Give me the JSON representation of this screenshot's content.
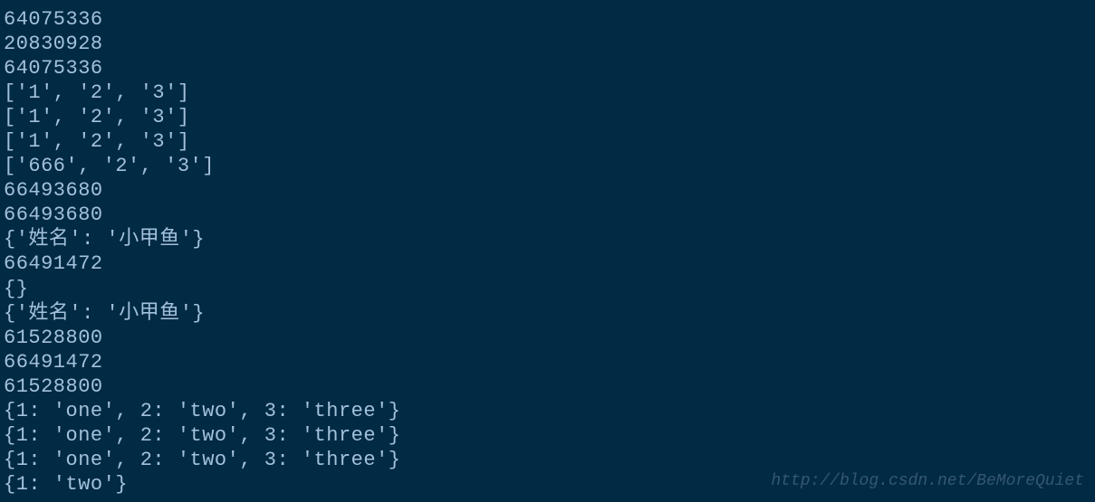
{
  "console": {
    "lines": [
      "64075336",
      "20830928",
      "64075336",
      "['1', '2', '3']",
      "['1', '2', '3']",
      "['1', '2', '3']",
      "['666', '2', '3']",
      "66493680",
      "66493680",
      "{'姓名': '小甲鱼'}",
      "66491472",
      "{}",
      "{'姓名': '小甲鱼'}",
      "61528800",
      "66491472",
      "61528800",
      "{1: 'one', 2: 'two', 3: 'three'}",
      "{1: 'one', 2: 'two', 3: 'three'}",
      "{1: 'one', 2: 'two', 3: 'three'}",
      "{1: 'two'}"
    ]
  },
  "watermark": {
    "text": "http://blog.csdn.net/BeMoreQuiet"
  }
}
